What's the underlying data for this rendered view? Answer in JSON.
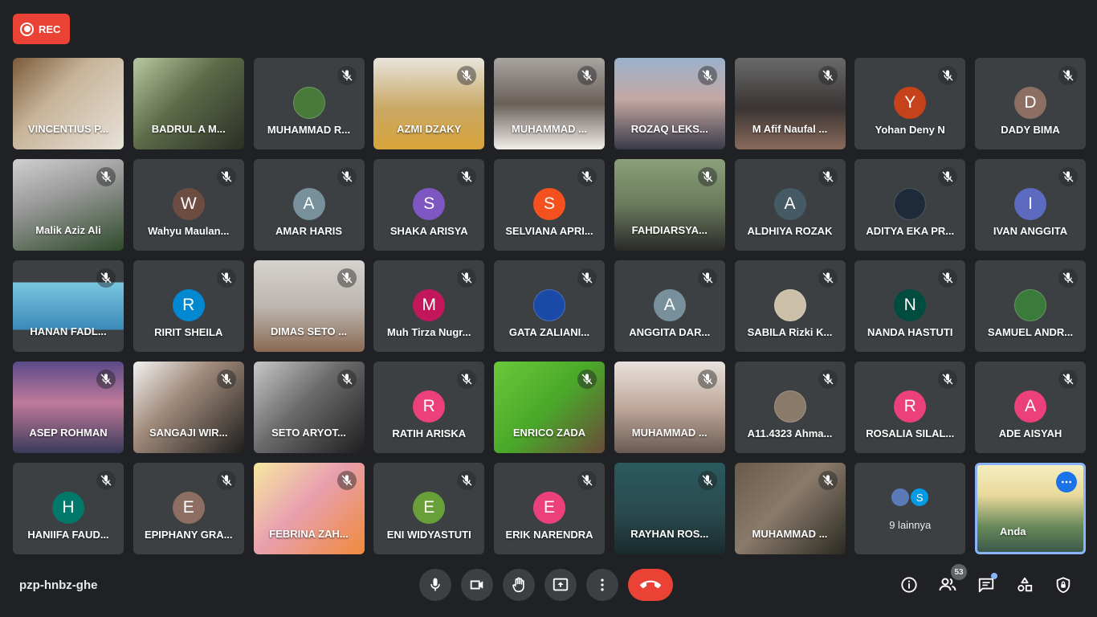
{
  "rec_label": "REC",
  "meeting_code": "pzp-hnbz-ghe",
  "participant_count": "53",
  "colors": {
    "background": "#202124",
    "tile": "#3c4043",
    "accent": "#8ab4f8",
    "danger": "#ea4335"
  },
  "tiles": [
    {
      "name": "VINCENTIUS P...",
      "type": "video",
      "bg": "linear-gradient(135deg,#7a5a3a,#c8b49a 40%,#e8e2d8)",
      "muted": false
    },
    {
      "name": "BADRUL A M...",
      "type": "video",
      "bg": "linear-gradient(135deg,#b8c8a0,#5c6a48 45%,#2c2f26)",
      "muted": false
    },
    {
      "name": "MUHAMMAD R...",
      "type": "photo",
      "avatar_color": "#4a7a3a",
      "muted": true
    },
    {
      "name": "AZMI DZAKY",
      "type": "video",
      "bg": "linear-gradient(180deg,#e8e4dc,#c9a864 55%,#d8a43a)",
      "muted": true
    },
    {
      "name": "MUHAMMAD ...",
      "type": "video",
      "bg": "linear-gradient(180deg,#a8a4a0,#6a605a 50%,#f2eeea)",
      "muted": true
    },
    {
      "name": "ROZAQ LEKS...",
      "type": "video",
      "bg": "linear-gradient(180deg,#9bb2cc,#c4a8a4 45%,#3a3a48)",
      "muted": true
    },
    {
      "name": "M Afif Naufal ...",
      "type": "video",
      "bg": "linear-gradient(180deg,#6a6a6a,#3a3434 55%,#8a6a5a)",
      "muted": true
    },
    {
      "name": "Yohan Deny N",
      "type": "avatar",
      "initial": "Y",
      "avatar_color": "#c5421a",
      "muted": true
    },
    {
      "name": "DADY BIMA",
      "type": "avatar",
      "initial": "D",
      "avatar_color": "#8d6e63",
      "muted": true
    },
    {
      "name": "Malik Aziz Ali",
      "type": "video",
      "bg": "linear-gradient(160deg,#d0d0d0,#9a9a9a 40%,#2e4a2a)",
      "muted": true
    },
    {
      "name": "Wahyu Maulan...",
      "type": "avatar",
      "initial": "W",
      "avatar_color": "#6d4c41",
      "muted": true
    },
    {
      "name": "AMAR HARIS",
      "type": "avatar",
      "initial": "A",
      "avatar_color": "#78909c",
      "muted": true
    },
    {
      "name": "SHAKA ARISYA",
      "type": "avatar",
      "initial": "S",
      "avatar_color": "#7e57c2",
      "muted": true
    },
    {
      "name": "SELVIANA APRI...",
      "type": "avatar",
      "initial": "S",
      "avatar_color": "#f4511e",
      "muted": true
    },
    {
      "name": "FAHDIARSYA...",
      "type": "video",
      "bg": "linear-gradient(180deg,#8aa07a,#6a7a5a 50%,#2a2a2a)",
      "muted": true
    },
    {
      "name": "ALDHIYA ROZAK",
      "type": "avatar",
      "initial": "A",
      "avatar_color": "#455a64",
      "muted": true
    },
    {
      "name": "ADITYA EKA PR...",
      "type": "photo",
      "avatar_color": "#1c2a3a",
      "muted": true
    },
    {
      "name": "IVAN ANGGITA",
      "type": "avatar",
      "initial": "I",
      "avatar_color": "#5c6bc0",
      "muted": true
    },
    {
      "name": "HANAN FADL...",
      "type": "video",
      "bg": "linear-gradient(180deg,#3c4043 0%,#3c4043 24%,#7ac6e0 24%,#3a8ab8 76%,#3c4043 76%)",
      "muted": true
    },
    {
      "name": "RIRIT SHEILA",
      "type": "avatar",
      "initial": "R",
      "avatar_color": "#0288d1",
      "muted": true
    },
    {
      "name": "DIMAS SETO ...",
      "type": "video",
      "bg": "linear-gradient(180deg,#d6d2ce,#bdb6b0 50%,#8a6a52)",
      "muted": true
    },
    {
      "name": "Muh Tirza Nugr...",
      "type": "avatar",
      "initial": "M",
      "avatar_color": "#c2185b",
      "muted": true
    },
    {
      "name": "GATA ZALIANI...",
      "type": "photo",
      "avatar_color": "#1a4aa8",
      "muted": true
    },
    {
      "name": "ANGGITA DAR...",
      "type": "avatar",
      "initial": "A",
      "avatar_color": "#78909c",
      "muted": true
    },
    {
      "name": "SABILA Rizki K...",
      "type": "photo",
      "avatar_color": "#cbbfa8",
      "muted": true
    },
    {
      "name": "NANDA HASTUTI",
      "type": "avatar",
      "initial": "N",
      "avatar_color": "#004d40",
      "muted": true
    },
    {
      "name": "SAMUEL ANDR...",
      "type": "photo",
      "avatar_color": "#3a7a3a",
      "muted": true
    },
    {
      "name": "ASEP ROHMAN",
      "type": "video",
      "bg": "linear-gradient(180deg,#5a4a8a,#c07a9a 45%,#3a3a5a)",
      "muted": true
    },
    {
      "name": "SANGAJI WIR...",
      "type": "video",
      "bg": "linear-gradient(135deg,#f2f2f2,#a08a7a 40%,#1e1e1e)",
      "muted": true
    },
    {
      "name": "SETO ARYOT...",
      "type": "video",
      "bg": "linear-gradient(135deg,#c8c8c8,#6a6a6a 45%,#1e1e1e)",
      "muted": true
    },
    {
      "name": "RATIH ARISKA",
      "type": "avatar",
      "initial": "R",
      "avatar_color": "#ec407a",
      "muted": true
    },
    {
      "name": "ENRICO ZADA",
      "type": "video",
      "bg": "linear-gradient(135deg,#6ac83a,#4aa82a 50%,#6a4a3a)",
      "muted": true
    },
    {
      "name": "MUHAMMAD ...",
      "type": "video",
      "bg": "linear-gradient(180deg,#e8e2dc,#c0a89a 50%,#6a5a52)",
      "muted": true
    },
    {
      "name": "A11.4323 Ahma...",
      "type": "photo",
      "avatar_color": "#8a7a6a",
      "muted": true
    },
    {
      "name": "ROSALIA SILAL...",
      "type": "avatar",
      "initial": "R",
      "avatar_color": "#ec407a",
      "muted": true
    },
    {
      "name": "ADE AISYAH",
      "type": "avatar",
      "initial": "A",
      "avatar_color": "#ec407a",
      "muted": true
    },
    {
      "name": "HANIIFA FAUD...",
      "type": "avatar",
      "initial": "H",
      "avatar_color": "#00796b",
      "muted": true
    },
    {
      "name": "EPIPHANY GRA...",
      "type": "avatar",
      "initial": "E",
      "avatar_color": "#8d6e63",
      "muted": true
    },
    {
      "name": "FEBRINA ZAH...",
      "type": "video",
      "bg": "linear-gradient(135deg,#f6e8a0,#e8a0b0 45%,#f08a3a)",
      "muted": true
    },
    {
      "name": "ENI WIDYASTUTI",
      "type": "avatar",
      "initial": "E",
      "avatar_color": "#689f38",
      "muted": true
    },
    {
      "name": "ERIK NARENDRA",
      "type": "avatar",
      "initial": "E",
      "avatar_color": "#ec407a",
      "muted": true
    },
    {
      "name": "RAYHAN ROS...",
      "type": "video",
      "bg": "linear-gradient(180deg,#2a5a5e,#2a4a4e 55%,#1a2a2c)",
      "muted": true
    },
    {
      "name": "MUHAMMAD ...",
      "type": "video",
      "bg": "linear-gradient(135deg,#6a5a4a,#8a7a6a 45%,#2a2a22)",
      "muted": true
    },
    {
      "name": "9 lainnya",
      "type": "more",
      "muted": false
    },
    {
      "name": "Anda",
      "type": "self",
      "bg": "linear-gradient(180deg,#f6eec0,#e8d89a 35%,#6a8a5a 70%,#3a5a4a)",
      "muted": false
    }
  ]
}
